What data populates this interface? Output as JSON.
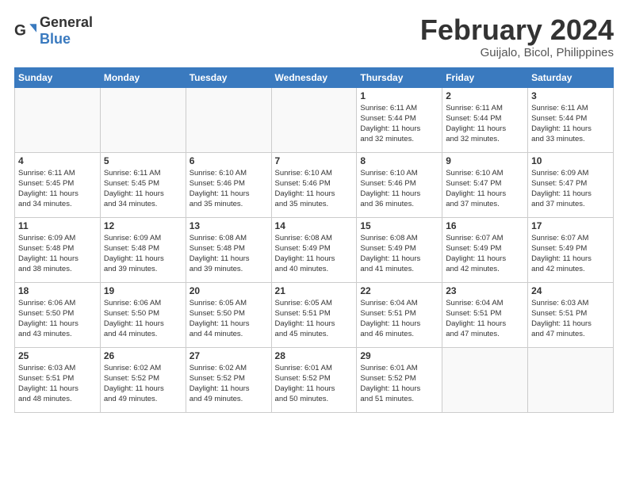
{
  "logo": {
    "text_general": "General",
    "text_blue": "Blue"
  },
  "header": {
    "month": "February 2024",
    "location": "Guijalo, Bicol, Philippines"
  },
  "days_of_week": [
    "Sunday",
    "Monday",
    "Tuesday",
    "Wednesday",
    "Thursday",
    "Friday",
    "Saturday"
  ],
  "weeks": [
    [
      {
        "day": "",
        "info": ""
      },
      {
        "day": "",
        "info": ""
      },
      {
        "day": "",
        "info": ""
      },
      {
        "day": "",
        "info": ""
      },
      {
        "day": "1",
        "info": "Sunrise: 6:11 AM\nSunset: 5:44 PM\nDaylight: 11 hours\nand 32 minutes."
      },
      {
        "day": "2",
        "info": "Sunrise: 6:11 AM\nSunset: 5:44 PM\nDaylight: 11 hours\nand 32 minutes."
      },
      {
        "day": "3",
        "info": "Sunrise: 6:11 AM\nSunset: 5:44 PM\nDaylight: 11 hours\nand 33 minutes."
      }
    ],
    [
      {
        "day": "4",
        "info": "Sunrise: 6:11 AM\nSunset: 5:45 PM\nDaylight: 11 hours\nand 34 minutes."
      },
      {
        "day": "5",
        "info": "Sunrise: 6:11 AM\nSunset: 5:45 PM\nDaylight: 11 hours\nand 34 minutes."
      },
      {
        "day": "6",
        "info": "Sunrise: 6:10 AM\nSunset: 5:46 PM\nDaylight: 11 hours\nand 35 minutes."
      },
      {
        "day": "7",
        "info": "Sunrise: 6:10 AM\nSunset: 5:46 PM\nDaylight: 11 hours\nand 35 minutes."
      },
      {
        "day": "8",
        "info": "Sunrise: 6:10 AM\nSunset: 5:46 PM\nDaylight: 11 hours\nand 36 minutes."
      },
      {
        "day": "9",
        "info": "Sunrise: 6:10 AM\nSunset: 5:47 PM\nDaylight: 11 hours\nand 37 minutes."
      },
      {
        "day": "10",
        "info": "Sunrise: 6:09 AM\nSunset: 5:47 PM\nDaylight: 11 hours\nand 37 minutes."
      }
    ],
    [
      {
        "day": "11",
        "info": "Sunrise: 6:09 AM\nSunset: 5:48 PM\nDaylight: 11 hours\nand 38 minutes."
      },
      {
        "day": "12",
        "info": "Sunrise: 6:09 AM\nSunset: 5:48 PM\nDaylight: 11 hours\nand 39 minutes."
      },
      {
        "day": "13",
        "info": "Sunrise: 6:08 AM\nSunset: 5:48 PM\nDaylight: 11 hours\nand 39 minutes."
      },
      {
        "day": "14",
        "info": "Sunrise: 6:08 AM\nSunset: 5:49 PM\nDaylight: 11 hours\nand 40 minutes."
      },
      {
        "day": "15",
        "info": "Sunrise: 6:08 AM\nSunset: 5:49 PM\nDaylight: 11 hours\nand 41 minutes."
      },
      {
        "day": "16",
        "info": "Sunrise: 6:07 AM\nSunset: 5:49 PM\nDaylight: 11 hours\nand 42 minutes."
      },
      {
        "day": "17",
        "info": "Sunrise: 6:07 AM\nSunset: 5:49 PM\nDaylight: 11 hours\nand 42 minutes."
      }
    ],
    [
      {
        "day": "18",
        "info": "Sunrise: 6:06 AM\nSunset: 5:50 PM\nDaylight: 11 hours\nand 43 minutes."
      },
      {
        "day": "19",
        "info": "Sunrise: 6:06 AM\nSunset: 5:50 PM\nDaylight: 11 hours\nand 44 minutes."
      },
      {
        "day": "20",
        "info": "Sunrise: 6:05 AM\nSunset: 5:50 PM\nDaylight: 11 hours\nand 44 minutes."
      },
      {
        "day": "21",
        "info": "Sunrise: 6:05 AM\nSunset: 5:51 PM\nDaylight: 11 hours\nand 45 minutes."
      },
      {
        "day": "22",
        "info": "Sunrise: 6:04 AM\nSunset: 5:51 PM\nDaylight: 11 hours\nand 46 minutes."
      },
      {
        "day": "23",
        "info": "Sunrise: 6:04 AM\nSunset: 5:51 PM\nDaylight: 11 hours\nand 47 minutes."
      },
      {
        "day": "24",
        "info": "Sunrise: 6:03 AM\nSunset: 5:51 PM\nDaylight: 11 hours\nand 47 minutes."
      }
    ],
    [
      {
        "day": "25",
        "info": "Sunrise: 6:03 AM\nSunset: 5:51 PM\nDaylight: 11 hours\nand 48 minutes."
      },
      {
        "day": "26",
        "info": "Sunrise: 6:02 AM\nSunset: 5:52 PM\nDaylight: 11 hours\nand 49 minutes."
      },
      {
        "day": "27",
        "info": "Sunrise: 6:02 AM\nSunset: 5:52 PM\nDaylight: 11 hours\nand 49 minutes."
      },
      {
        "day": "28",
        "info": "Sunrise: 6:01 AM\nSunset: 5:52 PM\nDaylight: 11 hours\nand 50 minutes."
      },
      {
        "day": "29",
        "info": "Sunrise: 6:01 AM\nSunset: 5:52 PM\nDaylight: 11 hours\nand 51 minutes."
      },
      {
        "day": "",
        "info": ""
      },
      {
        "day": "",
        "info": ""
      }
    ]
  ]
}
